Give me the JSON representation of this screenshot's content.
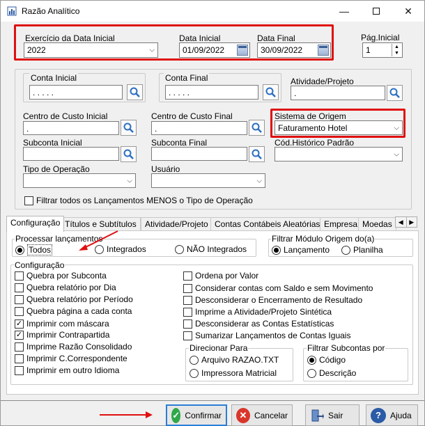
{
  "window": {
    "title": "Razão Analítico",
    "minimize_icon": "minimize-icon",
    "maximize_icon": "maximize-icon",
    "close_icon": "close-icon"
  },
  "period": {
    "exercicio_label": "Exercício da Data Inicial",
    "exercicio_value": "2022",
    "data_inicial_label": "Data Inicial",
    "data_inicial_value": "01/09/2022",
    "data_final_label": "Data Final",
    "data_final_value": "30/09/2022",
    "pag_inicial_label": "Pág.Inicial",
    "pag_inicial_value": "1"
  },
  "filters": {
    "conta_inicial_label": "Conta Inicial",
    "conta_inicial_value": ". . . . .",
    "conta_final_label": "Conta Final",
    "conta_final_value": ". . . . .",
    "atividade_label": "Atividade/Projeto",
    "atividade_value": ".",
    "cc_inicial_label": "Centro de Custo Inicial",
    "cc_inicial_value": ".",
    "cc_final_label": "Centro de Custo Final",
    "cc_final_value": ".",
    "sistema_origem_label": "Sistema de Origem",
    "sistema_origem_value": "Faturamento Hotel",
    "subconta_inicial_label": "Subconta Inicial",
    "subconta_inicial_value": "",
    "subconta_final_label": "Subconta Final",
    "subconta_final_value": "",
    "cod_historico_label": "Cód.Histórico Padrão",
    "cod_historico_value": "",
    "tipo_operacao_label": "Tipo de Operação",
    "tipo_operacao_value": "",
    "usuario_label": "Usuário",
    "usuario_value": "",
    "filtrar_todos_label": "Filtrar todos os Lançamentos MENOS o Tipo de Operação"
  },
  "tabs": [
    {
      "label": "Configuração"
    },
    {
      "label": "Títulos e Subtítulos"
    },
    {
      "label": "Atividade/Projeto"
    },
    {
      "label": "Contas Contábeis Aleatórias"
    },
    {
      "label": "Empresa"
    },
    {
      "label": "Moedas"
    }
  ],
  "processar": {
    "legend": "Processar lançamentos",
    "opt_todos": "Todos",
    "opt_integrados": "Integrados",
    "opt_nao_integrados": "NÃO Integrados",
    "selected": "Todos"
  },
  "filtrar_modulo": {
    "legend": "Filtrar Módulo Origem do(a)",
    "opt_lancamento": "Lançamento",
    "opt_planilha": "Planilha",
    "selected": "Lançamento"
  },
  "configuracao": {
    "legend": "Configuração",
    "left": [
      {
        "label": "Quebra por Subconta",
        "checked": false
      },
      {
        "label": "Quebra relatório por Dia",
        "checked": false
      },
      {
        "label": "Quebra relatório por Período",
        "checked": false
      },
      {
        "label": "Quebra página a cada conta",
        "checked": false
      },
      {
        "label": "Imprimir com máscara",
        "checked": true
      },
      {
        "label": "Imprimir Contrapartida",
        "checked": true
      },
      {
        "label": "Imprime Razão Consolidado",
        "checked": false
      },
      {
        "label": "Imprimir C.Correspondente",
        "checked": false
      },
      {
        "label": "Imprimir em outro Idioma",
        "checked": false
      }
    ],
    "right": [
      {
        "label": "Ordena por Valor",
        "checked": false
      },
      {
        "label": "Considerar contas com Saldo e sem Movimento",
        "checked": false
      },
      {
        "label": "Desconsiderar o Encerramento de Resultado",
        "checked": false
      },
      {
        "label": "Imprime a Atividade/Projeto Sintética",
        "checked": false
      },
      {
        "label": "Desconsiderar as Contas Estatísticas",
        "checked": false
      },
      {
        "label": "Sumarizar Lançamentos de Contas Iguais",
        "checked": false
      }
    ]
  },
  "direcionar": {
    "legend": "Direcionar  Para",
    "opt_arquivo": "Arquivo RAZAO.TXT",
    "opt_impressora": "Impressora Matricial"
  },
  "filtrar_subcontas": {
    "legend": "Filtrar Subcontas por",
    "opt_codigo": "Código",
    "opt_descricao": "Descrição",
    "selected": "Código"
  },
  "buttons": {
    "confirmar": "Confirmar",
    "cancelar": "Cancelar",
    "sair": "Sair",
    "ajuda": "Ajuda"
  },
  "colors": {
    "highlight_red": "#e01010",
    "accent_blue": "#2a7fd4"
  }
}
